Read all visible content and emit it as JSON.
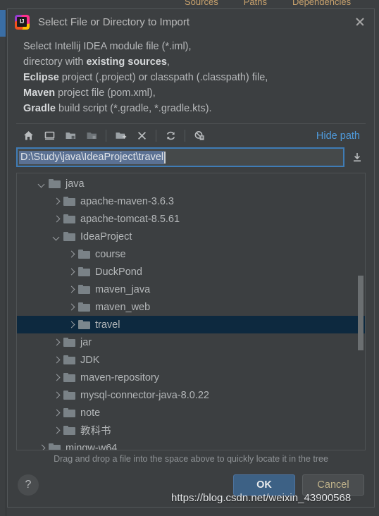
{
  "background": {
    "tabs": [
      "Sources",
      "Paths",
      "Dependencies"
    ]
  },
  "dialog": {
    "title": "Select File or Directory to Import",
    "app_icon": "intellij-idea-icon",
    "close_icon": "close-icon",
    "description": [
      {
        "segments": [
          {
            "text": "Select Intellij IDEA module file (*.iml),",
            "bold": false
          }
        ]
      },
      {
        "segments": [
          {
            "text": "directory with ",
            "bold": false
          },
          {
            "text": "existing sources",
            "bold": true
          },
          {
            "text": ",",
            "bold": false
          }
        ]
      },
      {
        "segments": [
          {
            "text": "Eclipse",
            "bold": true
          },
          {
            "text": " project (.project) or classpath (.classpath) file,",
            "bold": false
          }
        ]
      },
      {
        "segments": [
          {
            "text": "Maven",
            "bold": true
          },
          {
            "text": " project file (pom.xml),",
            "bold": false
          }
        ]
      },
      {
        "segments": [
          {
            "text": "Gradle",
            "bold": true
          },
          {
            "text": " build script (*.gradle, *.gradle.kts).",
            "bold": false
          }
        ]
      }
    ]
  },
  "toolbar": {
    "buttons": [
      {
        "icon": "home-icon",
        "name": "toolbar-home"
      },
      {
        "icon": "desktop-icon",
        "name": "toolbar-desktop"
      },
      {
        "icon": "project-folder-icon",
        "name": "toolbar-project-dir"
      },
      {
        "icon": "module-folder-icon",
        "name": "toolbar-module-dir"
      },
      {
        "icon": "new-folder-icon",
        "name": "toolbar-new-folder"
      },
      {
        "icon": "delete-icon",
        "name": "toolbar-delete"
      },
      {
        "icon": "refresh-icon",
        "name": "toolbar-refresh"
      },
      {
        "icon": "show-hidden-icon",
        "name": "toolbar-show-hidden"
      }
    ],
    "hide_path_label": "Hide path"
  },
  "path_field": {
    "value": "D:\\Study\\java\\IdeaProject\\travel",
    "selected": true,
    "download_icon": "download-icon"
  },
  "tree": {
    "rows": [
      {
        "label": "java",
        "depth": 2,
        "state": "expanded",
        "selected": false
      },
      {
        "label": "apache-maven-3.6.3",
        "depth": 3,
        "state": "collapsed",
        "selected": false
      },
      {
        "label": "apache-tomcat-8.5.61",
        "depth": 3,
        "state": "collapsed",
        "selected": false
      },
      {
        "label": "IdeaProject",
        "depth": 3,
        "state": "expanded",
        "selected": false
      },
      {
        "label": "course",
        "depth": 4,
        "state": "collapsed",
        "selected": false
      },
      {
        "label": "DuckPond",
        "depth": 4,
        "state": "collapsed",
        "selected": false
      },
      {
        "label": "maven_java",
        "depth": 4,
        "state": "collapsed",
        "selected": false
      },
      {
        "label": "maven_web",
        "depth": 4,
        "state": "collapsed",
        "selected": false
      },
      {
        "label": "travel",
        "depth": 4,
        "state": "collapsed",
        "selected": true
      },
      {
        "label": "jar",
        "depth": 3,
        "state": "collapsed",
        "selected": false
      },
      {
        "label": "JDK",
        "depth": 3,
        "state": "collapsed",
        "selected": false
      },
      {
        "label": "maven-repository",
        "depth": 3,
        "state": "collapsed",
        "selected": false
      },
      {
        "label": "mysql-connector-java-8.0.22",
        "depth": 3,
        "state": "collapsed",
        "selected": false
      },
      {
        "label": "note",
        "depth": 3,
        "state": "collapsed",
        "selected": false
      },
      {
        "label": "教科书",
        "depth": 3,
        "state": "collapsed",
        "selected": false
      },
      {
        "label": "mingw-w64",
        "depth": 2,
        "state": "collapsed",
        "selected": false
      }
    ],
    "scrollbar": {
      "thumb_top_pct": 37,
      "thumb_height_pct": 27
    }
  },
  "hint": "Drag and drop a file into the space above to quickly locate it in the tree",
  "footer": {
    "help_label": "?",
    "ok_label": "OK",
    "cancel_label": "Cancel"
  },
  "watermark": "https://blog.csdn.net/weixin_43900568",
  "colors": {
    "dialog_bg": "#3c3f41",
    "selection_row": "#0d293f",
    "accent_link": "#4f9bdc",
    "ok_button": "#3d6185",
    "path_border": "#3f7cb6",
    "path_selection": "#5b7193"
  }
}
